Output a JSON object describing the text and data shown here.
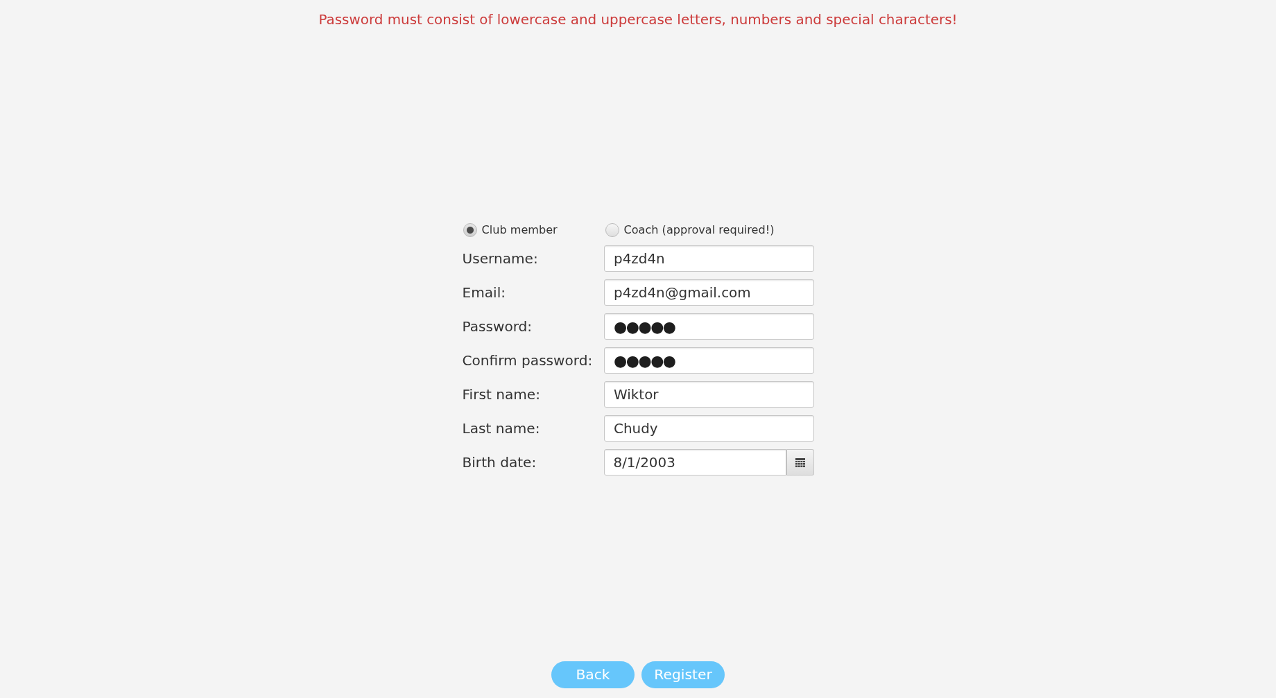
{
  "message": {
    "text": "Password must consist of lowercase and uppercase letters, numbers and special characters!",
    "kind": "error"
  },
  "account_type": [
    {
      "label": "Club member",
      "selected": true
    },
    {
      "label": "Coach (approval required!)",
      "selected": false
    }
  ],
  "fields": [
    {
      "label": "Username:",
      "value": "p4zd4n",
      "kind": "text"
    },
    {
      "label": "Email:",
      "value": "p4zd4n@gmail.com",
      "kind": "text"
    },
    {
      "label": "Password:",
      "value": "●●●●●",
      "kind": "password"
    },
    {
      "label": "Confirm password:",
      "value": "●●●●●",
      "kind": "password"
    },
    {
      "label": "First name:",
      "value": "Wiktor",
      "kind": "text"
    },
    {
      "label": "Last name:",
      "value": "Chudy",
      "kind": "text"
    },
    {
      "label": "Birth date:",
      "value": "8/1/2003",
      "kind": "date"
    }
  ],
  "buttons": [
    "Back",
    "Register"
  ]
}
